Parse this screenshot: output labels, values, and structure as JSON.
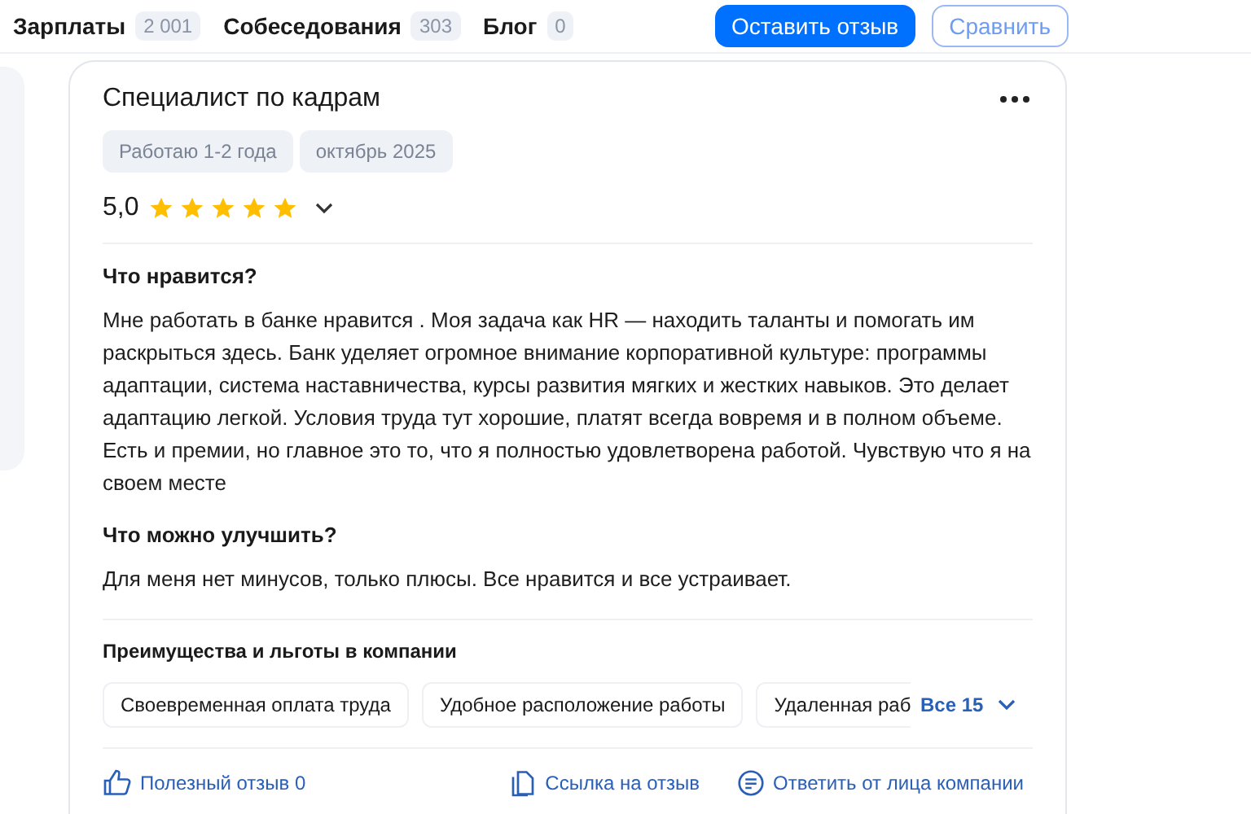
{
  "top_nav": {
    "items": [
      {
        "label": "Зарплаты",
        "count": "2 001"
      },
      {
        "label": "Собеседования",
        "count": "303"
      },
      {
        "label": "Блог",
        "count": "0"
      }
    ],
    "buttons": [
      {
        "label": "Оставить отзыв",
        "kind": "primary"
      },
      {
        "label": "Сравнить",
        "kind": "outline"
      }
    ]
  },
  "review": {
    "title": "Специалист по кадрам",
    "tags": [
      "Работаю 1-2 года",
      "октябрь 2025"
    ],
    "rating": "5,0",
    "stars": 5,
    "sections": [
      {
        "heading": "Что нравится?",
        "text": "Мне работать в банке нравится . Моя задача как HR — находить таланты и помогать им раскрыться здесь. Банк уделяет огромное внимание корпоративной культуре: программы адаптации, система наставничества, курсы развития мягких и жестких навыков. Это делает адаптацию легкой. Условия труда тут хорошие, платят всегда вовремя и в полном объеме. Есть и премии, но главное это то, что я полностью удовлетворена работой. Чувствую что я на своем месте"
      },
      {
        "heading": "Что можно улучшить?",
        "text": "Для меня нет минусов, только плюсы. Все нравится и все устраивает."
      }
    ],
    "benefits": {
      "heading": "Преимущества и льготы в компании",
      "items": [
        "Своевременная оплата труда",
        "Удобное расположение работы",
        "Удаленная раб"
      ],
      "more": "Все 15"
    },
    "actions": [
      {
        "label": "Полезный отзыв 0",
        "kind": "like"
      },
      {
        "label": "Ссылка на отзыв",
        "kind": "link"
      },
      {
        "label": "Ответить от лица компании",
        "kind": "reply"
      }
    ]
  }
}
